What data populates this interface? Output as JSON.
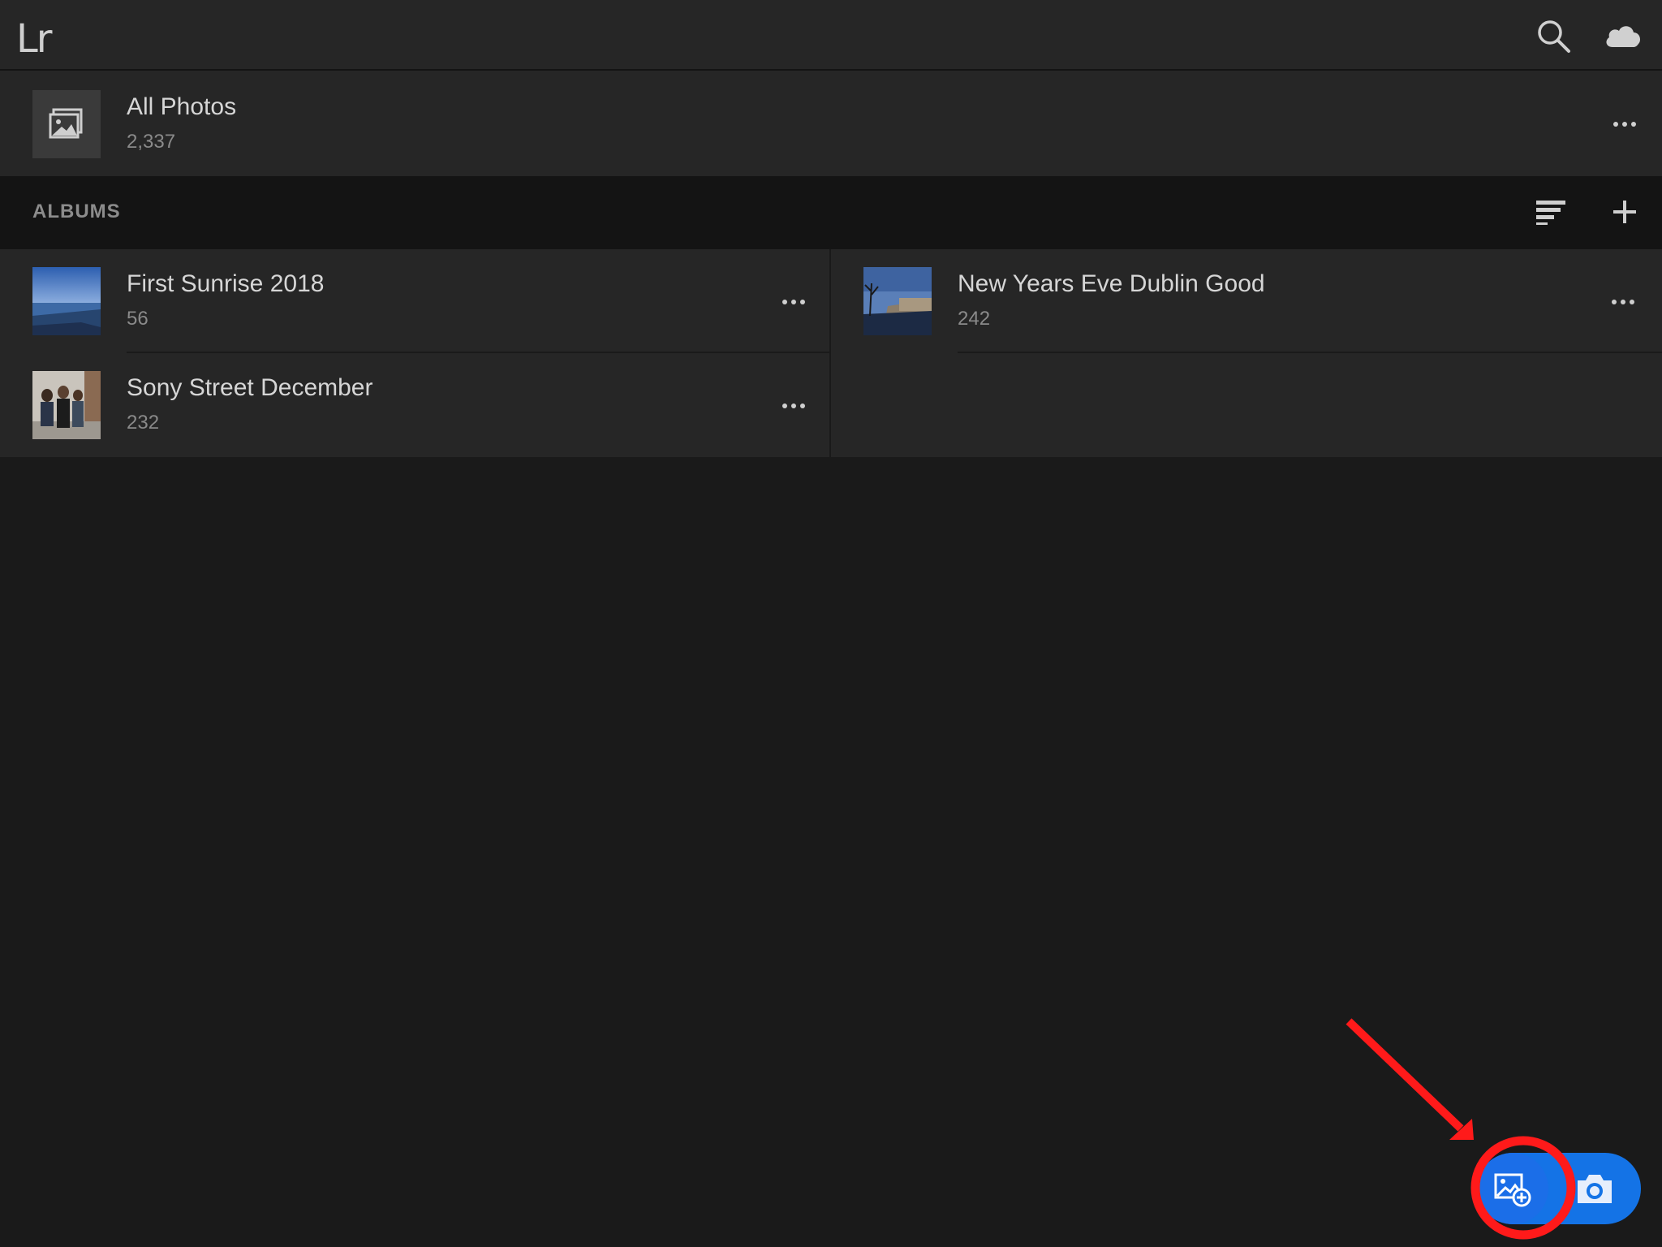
{
  "topbar": {
    "logo": "Lr",
    "icons": [
      "search-icon",
      "cloud-icon"
    ]
  },
  "all_photos": {
    "title": "All Photos",
    "count": "2,337"
  },
  "albums_header": {
    "label": "ALBUMS",
    "icons": [
      "sort-icon",
      "add-icon"
    ]
  },
  "albums": [
    {
      "title": "First Sunrise 2018",
      "count": "56"
    },
    {
      "title": "New Years Eve Dublin Good",
      "count": "242"
    },
    {
      "title": "Sony Street December",
      "count": "232"
    }
  ],
  "fab": {
    "icons": [
      "add-photo-icon",
      "camera-icon"
    ]
  },
  "colors": {
    "background": "#1a1a1a",
    "panel": "#262626",
    "accent": "#1473e6",
    "annotation": "#ff1a1a"
  }
}
